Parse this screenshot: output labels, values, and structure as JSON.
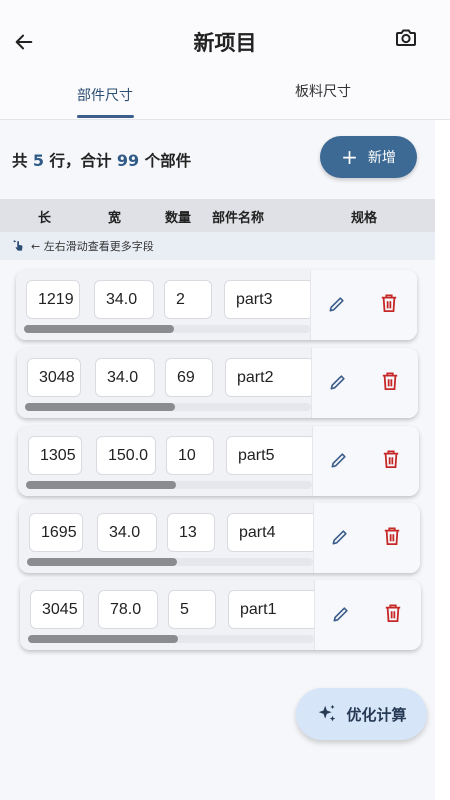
{
  "header": {
    "title": "新项目",
    "back_icon": "arrow-left-icon",
    "camera_icon": "camera-icon"
  },
  "tabs": [
    {
      "label": "部件尺寸",
      "active": true
    },
    {
      "label": "板料尺寸",
      "active": false
    }
  ],
  "summary": {
    "prefix": "共",
    "rows": "5",
    "mid": "行，合计",
    "parts": "99",
    "suffix": "个部件"
  },
  "add_button": {
    "label": "新增",
    "icon": "plus-icon"
  },
  "table": {
    "columns": [
      "长",
      "宽",
      "数量",
      "部件名称",
      "规格"
    ],
    "hint": "← 左右滑动查看更多字段",
    "rows": [
      {
        "length": "1219",
        "width": "34.0",
        "qty": "2",
        "name": "part3"
      },
      {
        "length": "3048",
        "width": "34.0",
        "qty": "69",
        "name": "part2"
      },
      {
        "length": "1305",
        "width": "150.0",
        "qty": "10",
        "name": "part5"
      },
      {
        "length": "1695",
        "width": "34.0",
        "qty": "13",
        "name": "part4"
      },
      {
        "length": "3045",
        "width": "78.0",
        "qty": "5",
        "name": "part1"
      }
    ]
  },
  "optimize_button": {
    "label": "优化计算",
    "icon": "sparkles-icon"
  },
  "colors": {
    "accent": "#3d6a94",
    "delete": "#c62828",
    "edit": "#3d5f8c"
  }
}
